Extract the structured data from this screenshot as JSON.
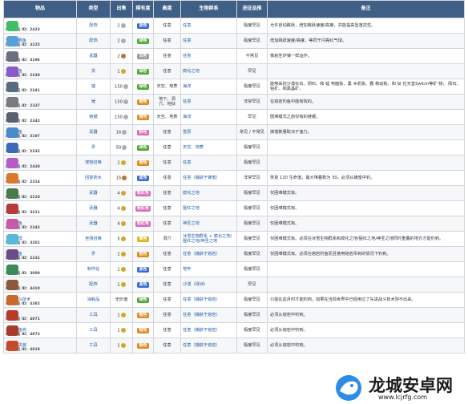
{
  "headers": [
    "物品",
    "类型",
    "出售",
    "稀有度",
    "高度",
    "生物群系",
    "进征品推",
    "备注"
  ],
  "rows": [
    {
      "name": "钓钩",
      "id_label": "内部物品 ID：",
      "id": "2423",
      "type": "配饰",
      "sell": "2",
      "sell_coin": "silver",
      "rarity": "蓝色",
      "rcolor": "#3a6bd4",
      "height": "任意",
      "biome": "任意",
      "chance": "极度罕见",
      "note": "允许自动跳跃，增加跳跃速度/高度，并能提高坠落抗性。",
      "icon": "#3fbf6a"
    },
    {
      "name": "气球河豚鱼",
      "id_label": "内部物品 ID：",
      "id": "3225",
      "type": "配饰",
      "sell": "2",
      "sell_coin": "silver",
      "rarity": "绿色",
      "rcolor": "#4fa836",
      "height": "任意",
      "biome": "任意",
      "chance": "极度罕见",
      "note": "增加跳跃速度/高度，等同于闪亮红气球。",
      "icon": "#5aa0d8"
    },
    {
      "name": "炸弹鱼",
      "id_label": "内部物品 ID：",
      "id": "3196",
      "type": "武器",
      "sell": "2",
      "sell_coin": "copper",
      "rarity": "白色",
      "rcolor": "#9a9a9a",
      "height": "任意",
      "biome": "任意",
      "chance": "不常见",
      "note": "像粘性炸弹一样运作。",
      "icon": "#6a7080"
    },
    {
      "name": "宝匣怪鱼",
      "id_label": "内部物品 ID：",
      "id": "2330",
      "type": "货",
      "sell": "1",
      "sell_coin": "gold",
      "rarity": "绿色",
      "rcolor": "#4fa836",
      "height": "任意",
      "biome": "腐化之地",
      "chance": "罕见",
      "note": "",
      "icon": "#8a5ac8"
    },
    {
      "name": "掠夺鲨",
      "id_label": "内部物品 ID：",
      "id": "2341",
      "type": "锚",
      "sell": "150",
      "sell_coin": "silver",
      "rarity": "绿色",
      "rcolor": "#4fa836",
      "height": "天空、地表",
      "biome": "海洋",
      "chance": "极度罕见",
      "note": "能够采挖沙漠化石、阴石、和 锰 电脑板、黑 木机板、霸 移动板、和 钛 任天堂Switch等矿 物， 陨石、钴矿、和黑晶矿。",
      "icon": "#5a6a80"
    },
    {
      "name": "岩鱼锤",
      "id_label": "内部物品 ID：",
      "id": "2337",
      "type": "锤",
      "sell": "150",
      "sell_coin": "silver",
      "rarity": "橙色",
      "rcolor": "#e08a1e",
      "height": "地下、洞穴、地狱",
      "biome": "任意",
      "chance": "非常罕见",
      "note": "在熔岩钓鱼中能有效的。",
      "icon": "#7a7a7a"
    },
    {
      "name": "锯齿鲨",
      "id_label": "内部物品 ID：",
      "id": "2342",
      "type": "链锯",
      "sell": "150",
      "sell_coin": "silver",
      "rarity": "橙色",
      "rcolor": "#e08a1e",
      "height": "天空、地表",
      "biome": "海洋",
      "chance": "罕见",
      "note": "困难模式之前仅有的链锯。",
      "icon": "#5a6070"
    },
    {
      "name": "草蜥飞鱼",
      "id_label": "内部物品 ID：",
      "id": "3197",
      "type": "武器",
      "sell": "16",
      "sell_coin": "silver",
      "rarity": "粉色",
      "rcolor": "#d86ab8",
      "height": "任意",
      "biome": "雪原",
      "chance": "常见 / 不常见",
      "note": "掉落数量取决于渔力。",
      "icon": "#4a8ac8"
    },
    {
      "name": "剑鱼",
      "id_label": "内部物品 ID：",
      "id": "2332",
      "type": "矛",
      "sell": "50",
      "sell_coin": "silver",
      "rarity": "绿色",
      "rcolor": "#4fa836",
      "height": "任意",
      "biome": "天空、地表",
      "chance": "极度罕见",
      "note": "",
      "icon": "#3a6ab8"
    },
    {
      "name": "松风鱼",
      "id_label": "内部物品 ID：",
      "id": "2420",
      "type": "宠物召唤",
      "sell": "2",
      "sell_coin": "gold",
      "rarity": "橙色",
      "rcolor": "#e08a1e",
      "height": "任意",
      "biome": "任意",
      "chance": "极度罕见",
      "note": "",
      "icon": "#b85ac8"
    },
    {
      "name": "蜂蜜鱼",
      "id_label": "内部物品 ID：",
      "id": "2314",
      "type": "回复药水",
      "sell": "15",
      "sell_coin": "copper",
      "rarity": "蓝色",
      "rcolor": "#3a6bd4",
      "height": "任意",
      "biome": "任意（捕获于蜂蜜）",
      "chance": "非常罕见",
      "note": "恢复 120 生命值，最大堆叠数为 30。必须从蜂蜜中钓。",
      "icon": "#d87a2a"
    },
    {
      "name": "毒弹鲸",
      "id_label": "内部物品 ID：",
      "id": "3210",
      "type": "武器",
      "sell": "4",
      "sell_coin": "gold",
      "rarity": "粉红色",
      "rcolor": "#d86ab8",
      "height": "任意",
      "biome": "腐化之地",
      "chance": "极度罕见",
      "note": "仅困难模式有。",
      "icon": "#4a7a4a"
    },
    {
      "name": "血飞鱼",
      "id_label": "内部物品 ID：",
      "id": "3211",
      "type": "武器",
      "sell": "4",
      "sell_coin": "gold",
      "rarity": "粉红色",
      "rcolor": "#d86ab8",
      "height": "任意",
      "biome": "猩红之地",
      "chance": "极度罕见",
      "note": "仅困难模式有。",
      "icon": "#b83a3a"
    },
    {
      "name": "水晶杉鱼",
      "id_label": "内部物品 ID：",
      "id": "2342",
      "type": "武器",
      "sell": "4",
      "sell_coin": "gold",
      "rarity": "粉红色",
      "rcolor": "#d86ab8",
      "height": "任意",
      "biome": "神圣之地",
      "chance": "极度罕见",
      "note": "仅困难模式有。",
      "icon": "#c85aa8"
    },
    {
      "name": "宠物水母",
      "id_label": "内部物品 ID：",
      "id": "3201",
      "type": "坐骑召唤",
      "sell": "5",
      "sell_coin": "gold",
      "rarity": "黄色",
      "rcolor": "#d8b41e",
      "height": "洞穴",
      "biome": "冰雪生物群系 + 腐化之地/猩红之地/神圣之地",
      "chance": "极度罕见",
      "note": "仅困难模式有。必须在冰雪生物群系和腐化之地/猩红之地/神圣之地同时重叠的地方才能钓到。",
      "icon": "#5ab8d8"
    },
    {
      "name": "猩红石鱼",
      "id_label": "内部物品 ID：",
      "id": "2331",
      "type": "矛",
      "sell": "1",
      "sell_coin": "gold",
      "rarity": "橙色",
      "rcolor": "#e08a1e",
      "height": "任意",
      "biome": "任意（捕获于熔岩）",
      "chance": "极度罕见",
      "note": "仅困难模式有。必须在熔岩钓鱼而且使用熔岩吊钩的情况下钓到。",
      "icon": "#6a4a8a"
    },
    {
      "name": "恶渔箱",
      "id_label": "内部物品 ID：",
      "id": "3000",
      "type": "制作站",
      "sell": "1",
      "sell_coin": "gold",
      "rarity": "蓝色",
      "rcolor": "#3a6bd4",
      "height": "任意",
      "biome": "地牢",
      "chance": "极度罕见",
      "note": "",
      "icon": "#3a8a5a"
    },
    {
      "name": "蛙腿",
      "id_label": "内部物品 ID：",
      "id": "4410",
      "type": "配饰",
      "sell": "1",
      "sell_coin": "gold",
      "rarity": "蓝色",
      "rcolor": "#3a6bd4",
      "height": "任意",
      "biome": "沙漠（绿洲）",
      "chance": "罕见",
      "note": "",
      "icon": "#8a5a3a"
    },
    {
      "name": "先进战斗技术",
      "id_label": "内部物品 ID：",
      "id": "4382",
      "type": "消耗品",
      "sell": "无价值",
      "sell_coin": "none",
      "rarity": "绿色",
      "rcolor": "#4fa836",
      "height": "任意",
      "biome": "任意（捕获于熔岩）",
      "chance": "极度罕见",
      "note": "只能在血月时才能钓到。如果在当前世界中已经用过了先进战斗技术则不出来。",
      "icon": "#c86a2a"
    },
    {
      "name": "熔岩钩",
      "id_label": "内部物品 ID：",
      "id": "4871",
      "type": "工具",
      "sell": "1",
      "sell_coin": "gold",
      "rarity": "橙色",
      "rcolor": "#e08a1e",
      "height": "任意",
      "biome": "任意（捕获于熔岩）",
      "chance": "极度罕见",
      "note": "必须从熔岩中钓到。",
      "icon": "#b83a2a"
    },
    {
      "name": "熔岩钓鱼钩",
      "id_label": "内部物品 ID：",
      "id": "4872",
      "type": "工具",
      "sell": "1",
      "sell_coin": "gold",
      "rarity": "橙色",
      "rcolor": "#e08a1e",
      "height": "任意",
      "biome": "任意（捕获于熔岩）",
      "chance": "极度罕见",
      "note": "必须从熔岩中钓到。",
      "icon": "#a83a2a"
    },
    {
      "name": "熔岩渔夫装",
      "id_label": "内部物品 ID：",
      "id": "4819",
      "type": "工具",
      "sell": "1",
      "sell_coin": "gold",
      "rarity": "橙色",
      "rcolor": "#e08a1e",
      "height": "任意",
      "biome": "任意（捕获于熔岩）",
      "chance": "极度罕见",
      "note": "必须从熔岩中钓到。",
      "icon": "#c84a2a"
    }
  ],
  "watermark": {
    "title": "龙城安卓网",
    "url": "www.lcjrfg.com"
  },
  "colors": {
    "header_bg": "#3f5f86",
    "link": "#1f5aa8",
    "border": "#d2d6dc"
  }
}
